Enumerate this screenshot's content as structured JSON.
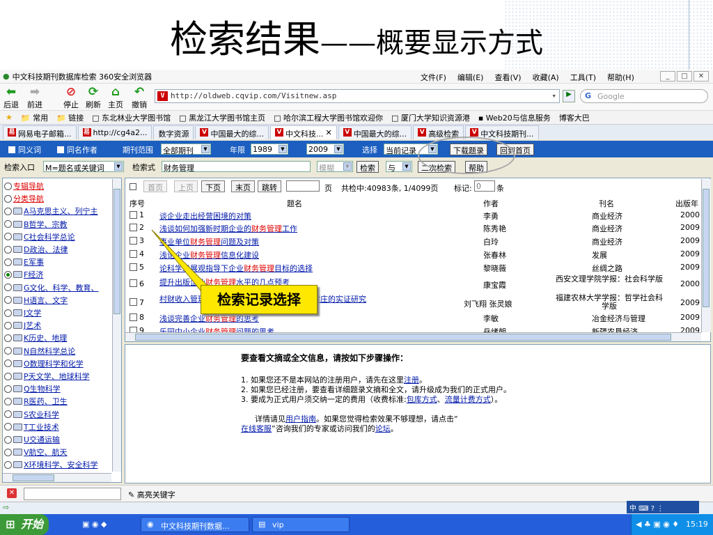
{
  "slide": {
    "title_main": "检索结果",
    "title_sub": "——概要显示方式"
  },
  "browser": {
    "title": "中文科技期刊数据库检索   360安全浏览器",
    "menu": [
      "文件(F)",
      "编辑(E)",
      "查看(V)",
      "收藏(A)",
      "工具(T)",
      "帮助(H)"
    ],
    "toolbar": [
      "后退",
      "前进",
      "停止",
      "刷新",
      "主页",
      "撤销"
    ],
    "address": "http://oldweb.cqvip.com/Visitnew.asp",
    "search_placeholder": "Google",
    "favorites": [
      "常用",
      "链接",
      "东北林业大学图书馆",
      "黑龙江大学图书馆主页",
      "哈尔滨工程大学图书馆欢迎你",
      "厦门大学知识资源港",
      "Web20与信息服务",
      "博客大巴"
    ],
    "tabs": [
      "网易电子邮箱...",
      "http://cg4a2...",
      "数字资源",
      "中国最大的综...",
      "中文科技...",
      "中国最大的综...",
      "高级检索",
      "中文科技期刊..."
    ]
  },
  "search": {
    "synonym": "同义词",
    "same_author": "同名作者",
    "range_label": "期刊范围",
    "range_value": "全部期刊",
    "year_label": "年限",
    "year_from": "1989",
    "year_to": "2009",
    "select_label": "选择",
    "select_value": "当前记录",
    "download_btn": "下载题录",
    "home_btn": "回到首页",
    "entry_label": "检索入口",
    "entry_value": "M=题名或关键词",
    "expr_label": "检索式",
    "expr_value": "财务管理",
    "mode_value": "模糊",
    "search_btn": "检索",
    "logic_value": "与",
    "second_search_btn": "二次检索",
    "help_btn": "帮助"
  },
  "tree": [
    {
      "label": "专辑导航",
      "red": true,
      "folder": false,
      "checked": false
    },
    {
      "label": "分类导航",
      "red": true,
      "folder": false,
      "checked": false
    },
    {
      "label": "A马克思主义、列宁主",
      "folder": true,
      "checked": false
    },
    {
      "label": "B哲学、宗教",
      "folder": true,
      "checked": false
    },
    {
      "label": "C社会科学总论",
      "folder": true,
      "checked": false
    },
    {
      "label": "D政治、法律",
      "folder": true,
      "checked": false
    },
    {
      "label": "E军事",
      "folder": true,
      "checked": false
    },
    {
      "label": "F经济",
      "folder": true,
      "checked": true
    },
    {
      "label": "G文化、科学、教育、",
      "folder": true,
      "checked": false
    },
    {
      "label": "H语言、文字",
      "folder": true,
      "checked": false
    },
    {
      "label": "I文学",
      "folder": true,
      "checked": false
    },
    {
      "label": "J艺术",
      "folder": true,
      "checked": false
    },
    {
      "label": "K历史、地理",
      "folder": true,
      "checked": false
    },
    {
      "label": "N自然科学总论",
      "folder": true,
      "checked": false
    },
    {
      "label": "O数理科学和化学",
      "folder": true,
      "checked": false
    },
    {
      "label": "P天文学、地球科学",
      "folder": true,
      "checked": false
    },
    {
      "label": "Q生物科学",
      "folder": true,
      "checked": false
    },
    {
      "label": "R医药、卫生",
      "folder": true,
      "checked": false
    },
    {
      "label": "S农业科学",
      "folder": true,
      "checked": false
    },
    {
      "label": "T工业技术",
      "folder": true,
      "checked": false
    },
    {
      "label": "U交通运输",
      "folder": true,
      "checked": false
    },
    {
      "label": "V航空、航天",
      "folder": true,
      "checked": false
    },
    {
      "label": "X环境科学、安全科学",
      "folder": true,
      "checked": false
    }
  ],
  "pager": {
    "first": "首页",
    "prev": "上页",
    "next": "下页",
    "last": "末页",
    "jump": "跳转",
    "page_unit": "页",
    "summary": "共检中:40983条, 1/4099页",
    "mark_label": "标记:",
    "mark_value": "0",
    "mark_unit": "条"
  },
  "table": {
    "headers": [
      "序号",
      "题名",
      "作者",
      "刊名",
      "出版年"
    ],
    "rows": [
      {
        "n": "1",
        "pre": "谈企业走出经营困境的对策",
        "hl": "",
        "post": "",
        "author": "李勇",
        "journal": "商业经济",
        "year": "2000"
      },
      {
        "n": "2",
        "pre": "浅谈如何加强新时期企业的",
        "hl": "财务管理",
        "post": "工作",
        "author": "陈秀艳",
        "journal": "商业经济",
        "year": "2009"
      },
      {
        "n": "3",
        "pre": "事业单位",
        "hl": "财务管理",
        "post": "问题及对策",
        "author": "白玲",
        "journal": "商业经济",
        "year": "2009"
      },
      {
        "n": "4",
        "pre": "浅论企业",
        "hl": "财务管理",
        "post": "信息化建设",
        "author": "张春林",
        "journal": "发展",
        "year": "2009"
      },
      {
        "n": "5",
        "pre": "论科学发展观指导下企业",
        "hl": "财务管理",
        "post": "目标的选择",
        "author": "黎晓薇",
        "journal": "丝绸之路",
        "year": "2009"
      },
      {
        "n": "6",
        "pre": "提升出版企业",
        "hl": "财务管理",
        "post": "水平的几点预考",
        "author": "康宝霞",
        "journal": "西安文理学院学报：社会科学版",
        "year": "2000"
      },
      {
        "n": "7",
        "pre": "村财收入管理对策研究——基于福州琅岐周边村庄的实证研究",
        "hl": "",
        "post": "",
        "author": "刘飞翔 张灵娘",
        "journal": "福建农林大学学报：哲学社会科学版",
        "year": "2009"
      },
      {
        "n": "8",
        "pre": "浅谈完善企业",
        "hl": "财务管理",
        "post": "的思考",
        "author": "李敏",
        "journal": "冶金经济与管理",
        "year": "2009"
      },
      {
        "n": "9",
        "pre": "乐园中小企业",
        "hl": "财务管理",
        "post": "问题的思考",
        "author": "岳绪朝",
        "journal": "新疆农垦经济",
        "year": "2009"
      }
    ]
  },
  "info": {
    "heading": "要查看文摘或全文信息，请按如下步骤操作：",
    "step1_pre": "1.  如果您还不是本网站的注册用户，请先在这里",
    "step1_link": "注册",
    "step1_post": "。",
    "step2": "2.  如果您已经注册，要查看详细题录文摘和全文，请升级成为我们的正式用户。",
    "step3_pre": "3.  要成为正式用户须交纳一定的费用（收费标准:",
    "step3_link1": "包库方式",
    "step3_mid": "、",
    "step3_link2": "流量计费方式",
    "step3_post": "）。",
    "more_pre": "详情请见",
    "more_link1": "用户指南",
    "more_mid": "。如果您觉得检索效果不够理想，请点击“",
    "more_link2": "在线客服",
    "more_mid2": "”咨询我们的专家或访问我们的",
    "more_link3": "论坛",
    "more_post": "。"
  },
  "callout": "检索记录选择",
  "findbar": {
    "highlight": "高亮关键字"
  },
  "taskbar": {
    "start": "开始",
    "task1": "中文科技期刊数据...",
    "task2": "vip",
    "clock": "15:19"
  }
}
